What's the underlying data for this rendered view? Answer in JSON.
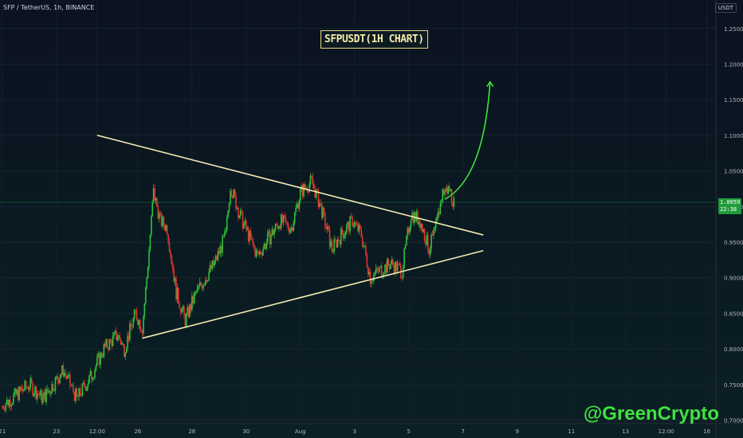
{
  "header": {
    "symbol_info": "SFP / TetherUS, 1h, BINANCE",
    "currency": "USDT"
  },
  "current_price": {
    "value": "1.0059",
    "countdown": "22:38",
    "level": 1.0059,
    "color": "#1f9c3b"
  },
  "watermark": "@GreenCrypto",
  "colors": {
    "up": "#26a69a",
    "up_bright": "#2ec23b",
    "down": "#e0342f",
    "trendline": "#f2eab0",
    "arrow": "#3fe23f",
    "axis_text": "#b2b5be"
  },
  "chart_data": {
    "type": "candlestick",
    "title": "SFPUSDT(1H CHART)",
    "yaxis": {
      "ticks": [
        "1.2500",
        "1.2000",
        "1.1500",
        "1.1000",
        "1.0500",
        "1.0000",
        "0.9500",
        "0.9000",
        "0.8500",
        "0.8000",
        "0.7500",
        "0.7000"
      ],
      "range": [
        0.695,
        1.29
      ]
    },
    "xaxis": {
      "ticks": [
        "21",
        "23",
        "12:00",
        "26",
        "28",
        "30",
        "Aug",
        "3",
        "5",
        "7",
        "9",
        "11",
        "13",
        "12:00",
        "16"
      ],
      "tick_times": [
        "2021-07-21 00:00",
        "2021-07-23 00:00",
        "2021-07-24 12:00",
        "2021-07-26 00:00",
        "2021-07-28 00:00",
        "2021-07-30 00:00",
        "2021-08-01 00:00",
        "2021-08-03 00:00",
        "2021-08-05 00:00",
        "2021-08-07 00:00",
        "2021-08-09 00:00",
        "2021-08-11 00:00",
        "2021-08-13 00:00",
        "2021-08-14 12:00",
        "2021-08-16 00:00"
      ],
      "range": [
        "2021-07-20 22:00",
        "2021-08-16 08:00"
      ]
    },
    "price_path": [
      [
        "2021-07-21 00:00",
        0.72
      ],
      [
        "2021-07-22 00:00",
        0.75
      ],
      [
        "2021-07-22 12:00",
        0.73
      ],
      [
        "2021-07-23 06:00",
        0.77
      ],
      [
        "2021-07-23 18:00",
        0.73
      ],
      [
        "2021-07-24 06:00",
        0.76
      ],
      [
        "2021-07-24 18:00",
        0.8
      ],
      [
        "2021-07-25 06:00",
        0.82
      ],
      [
        "2021-07-25 12:00",
        0.8
      ],
      [
        "2021-07-25 22:00",
        0.85
      ],
      [
        "2021-07-26 04:00",
        0.83
      ],
      [
        "2021-07-26 08:00",
        0.9
      ],
      [
        "2021-07-26 14:00",
        1.02
      ],
      [
        "2021-07-26 20:00",
        0.98
      ],
      [
        "2021-07-27 02:00",
        0.97
      ],
      [
        "2021-07-27 10:00",
        0.88
      ],
      [
        "2021-07-27 18:00",
        0.84
      ],
      [
        "2021-07-28 04:00",
        0.88
      ],
      [
        "2021-07-28 12:00",
        0.9
      ],
      [
        "2021-07-28 20:00",
        0.92
      ],
      [
        "2021-07-29 06:00",
        0.96
      ],
      [
        "2021-07-29 10:00",
        1.03
      ],
      [
        "2021-07-29 18:00",
        0.99
      ],
      [
        "2021-07-30 02:00",
        0.96
      ],
      [
        "2021-07-30 10:00",
        0.93
      ],
      [
        "2021-07-30 18:00",
        0.95
      ],
      [
        "2021-07-31 06:00",
        0.98
      ],
      [
        "2021-07-31 16:00",
        0.97
      ],
      [
        "2021-08-01 00:00",
        1.02
      ],
      [
        "2021-08-01 10:00",
        1.035
      ],
      [
        "2021-08-01 18:00",
        1.0
      ],
      [
        "2021-08-02 04:00",
        0.94
      ],
      [
        "2021-08-02 12:00",
        0.96
      ],
      [
        "2021-08-02 22:00",
        0.98
      ],
      [
        "2021-08-03 06:00",
        0.96
      ],
      [
        "2021-08-03 14:00",
        0.9
      ],
      [
        "2021-08-03 22:00",
        0.91
      ],
      [
        "2021-08-04 08:00",
        0.92
      ],
      [
        "2021-08-04 18:00",
        0.91
      ],
      [
        "2021-08-05 02:00",
        0.99
      ],
      [
        "2021-08-05 10:00",
        0.98
      ],
      [
        "2021-08-05 18:00",
        0.94
      ],
      [
        "2021-08-06 00:00",
        0.97
      ],
      [
        "2021-08-06 06:00",
        1.02
      ],
      [
        "2021-08-06 12:00",
        1.025
      ],
      [
        "2021-08-06 16:00",
        1.005
      ]
    ],
    "annotations": {
      "upper_trendline": [
        [
          "2021-07-24 12:00",
          1.1
        ],
        [
          "2021-08-07 18:00",
          0.96
        ]
      ],
      "lower_trendline": [
        [
          "2021-07-26 04:00",
          0.815
        ],
        [
          "2021-08-07 18:00",
          0.938
        ]
      ],
      "breakout_arrow": [
        [
          "2021-08-06 08:00",
          1.01
        ],
        [
          "2021-08-07 06:00",
          1.03
        ],
        [
          "2021-08-07 20:00",
          1.08
        ],
        [
          "2021-08-08 00:00",
          1.175
        ]
      ]
    }
  }
}
